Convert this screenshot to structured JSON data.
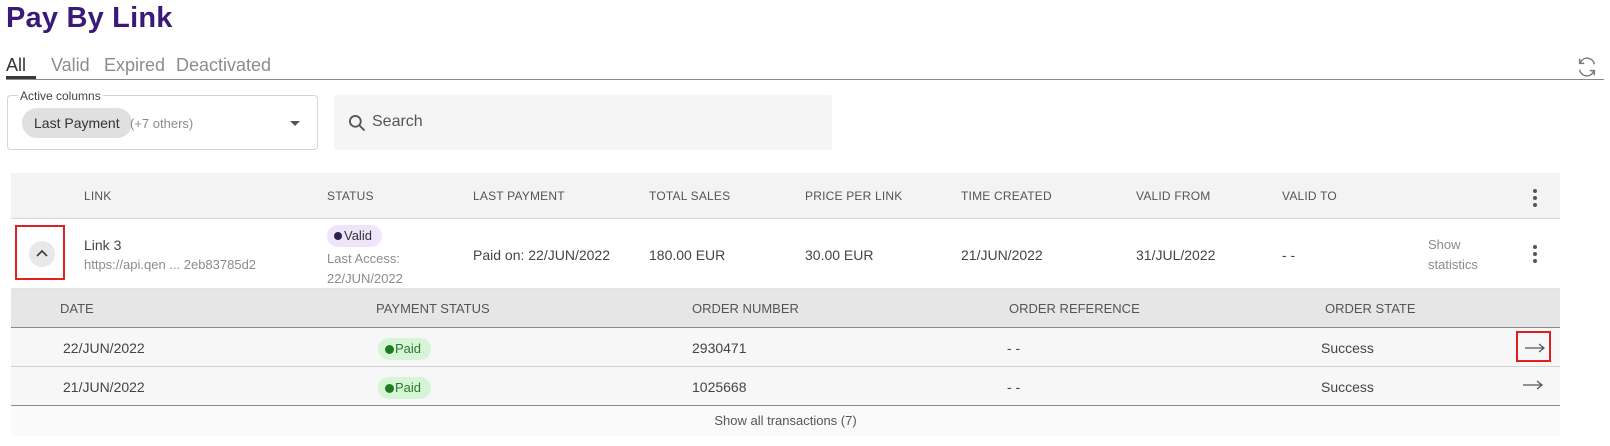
{
  "page": {
    "title": "Pay By Link"
  },
  "tabs": [
    {
      "label": "All",
      "active": true
    },
    {
      "label": "Valid",
      "active": false
    },
    {
      "label": "Expired",
      "active": false
    },
    {
      "label": "Deactivated",
      "active": false
    }
  ],
  "filters": {
    "active_columns_label": "Active columns",
    "chip_label": "Last Payment",
    "others": "(+7 others)",
    "search_placeholder": "Search"
  },
  "table": {
    "headers": [
      "LINK",
      "STATUS",
      "LAST PAYMENT",
      "TOTAL SALES",
      "PRICE PER LINK",
      "TIME CREATED",
      "VALID FROM",
      "VALID TO"
    ],
    "row": {
      "name": "Link 3",
      "url": "https://api.qen ... 2eb83785d2",
      "status": "Valid",
      "last_access_label": "Last Access:",
      "last_access_date": "22/JUN/2022",
      "last_payment": "Paid on: 22/JUN/2022",
      "total_sales": "180.00 EUR",
      "price_per_link": "30.00 EUR",
      "time_created": "21/JUN/2022",
      "valid_from": "31/JUL/2022",
      "valid_to": "- -",
      "show_statistics_1": "Show",
      "show_statistics_2": "statistics"
    },
    "sub_headers": [
      "DATE",
      "PAYMENT STATUS",
      "ORDER NUMBER",
      "ORDER REFERENCE",
      "ORDER STATE"
    ],
    "transactions": [
      {
        "date": "22/JUN/2022",
        "payment_status": "Paid",
        "order_number": "2930471",
        "order_reference": "- -",
        "order_state": "Success"
      },
      {
        "date": "21/JUN/2022",
        "payment_status": "Paid",
        "order_number": "1025668",
        "order_reference": "- -",
        "order_state": "Success"
      }
    ],
    "show_all": "Show all transactions (7)"
  },
  "colors": {
    "brand": "#3a1a78",
    "highlight": "#e02020",
    "paid_bg": "#d6f5d6",
    "valid_bg": "#efe5fb"
  }
}
